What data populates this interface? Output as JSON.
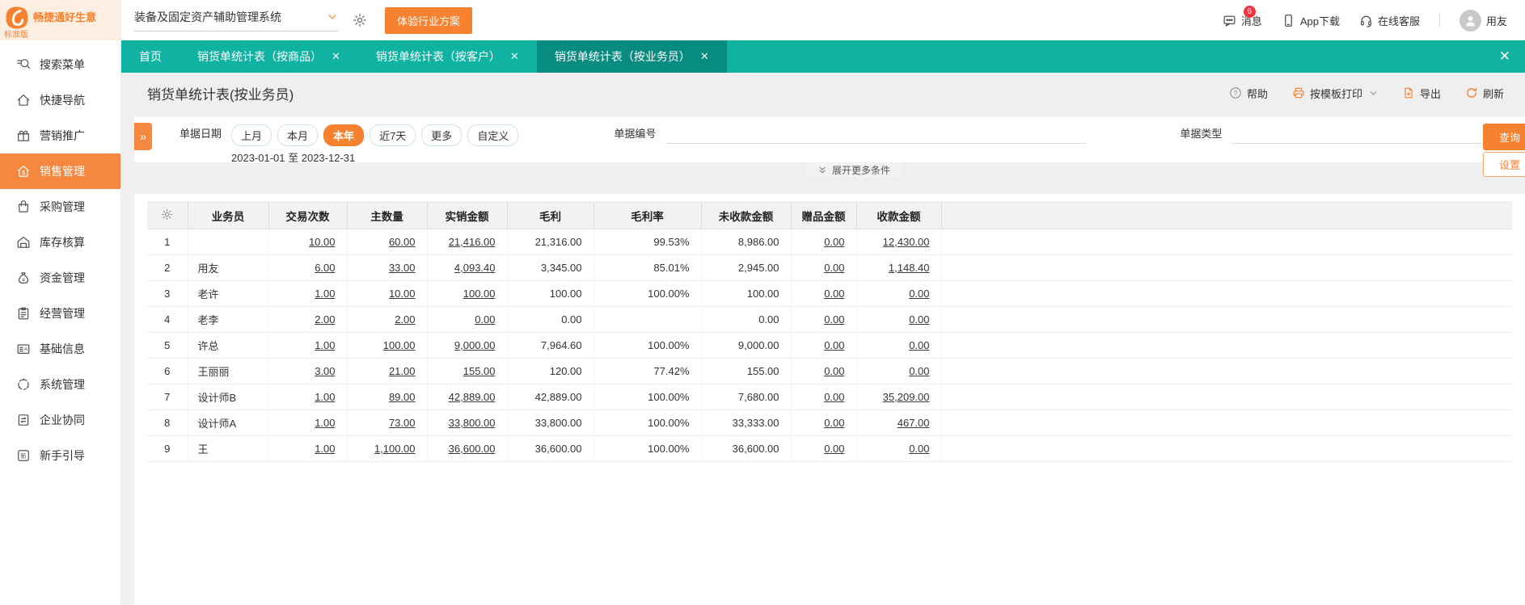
{
  "colors": {
    "accent_orange": "#f6812f",
    "teal": "#10b2a2",
    "teal_active_tab": "#088b80",
    "badge_red": "#f4333c",
    "sidebar_active": "#f6873f"
  },
  "topbar": {
    "logo_title": "畅捷通好生意",
    "logo_subtitle": "标准版",
    "system_select_value": "装备及固定资产辅助管理系统",
    "trial_button": "体验行业方案",
    "messages_label": "消息",
    "messages_badge": "6",
    "app_download_label": "App下载",
    "online_service_label": "在线客服",
    "username": "用友"
  },
  "sidebar": {
    "items": [
      {
        "label": "搜索菜单",
        "icon": "search",
        "active": false
      },
      {
        "label": "快捷导航",
        "icon": "home",
        "active": false
      },
      {
        "label": "营销推广",
        "icon": "gift",
        "active": false
      },
      {
        "label": "销售管理",
        "icon": "sales",
        "active": true
      },
      {
        "label": "采购管理",
        "icon": "bag",
        "active": false
      },
      {
        "label": "库存核算",
        "icon": "warehouse",
        "active": false
      },
      {
        "label": "资金管理",
        "icon": "moneybag",
        "active": false
      },
      {
        "label": "经营管理",
        "icon": "clipboard",
        "active": false
      },
      {
        "label": "基础信息",
        "icon": "idcard",
        "active": false
      },
      {
        "label": "系统管理",
        "icon": "system",
        "active": false
      },
      {
        "label": "企业协同",
        "icon": "collab",
        "active": false
      },
      {
        "label": "新手引导",
        "icon": "guide",
        "active": false
      }
    ]
  },
  "tabs": [
    {
      "label": "首页",
      "closable": false,
      "active": false
    },
    {
      "label": "销货单统计表（按商品）",
      "closable": true,
      "active": false
    },
    {
      "label": "销货单统计表（按客户）",
      "closable": true,
      "active": false
    },
    {
      "label": "销货单统计表（按业务员）",
      "closable": true,
      "active": true
    }
  ],
  "page": {
    "title": "销货单统计表(按业务员)",
    "toolbar": {
      "help": "帮助",
      "print": "按模板打印",
      "export": "导出",
      "refresh": "刷新"
    }
  },
  "filters": {
    "date_label": "单据日期",
    "date_options": [
      "上月",
      "本月",
      "本年",
      "近7天",
      "更多",
      "自定义"
    ],
    "date_selected": "本年",
    "date_range": "2023-01-01 至 2023-12-31",
    "doc_no_label": "单据编号",
    "doc_no_value": "",
    "doc_type_label": "单据类型",
    "doc_type_value": "",
    "query_button": "查询",
    "settings_button": "设置",
    "expand_more": "展开更多条件"
  },
  "table": {
    "columns": [
      "业务员",
      "交易次数",
      "主数量",
      "实销金额",
      "毛利",
      "毛利率",
      "未收款金额",
      "赠品金额",
      "收款金额"
    ],
    "link_value_indices": [
      0,
      1,
      2,
      6,
      7
    ],
    "rows": [
      {
        "no": "1",
        "name": "",
        "values": [
          "10.00",
          "60.00",
          "21,416.00",
          "21,316.00",
          "99.53%",
          "8,986.00",
          "0.00",
          "12,430.00"
        ]
      },
      {
        "no": "2",
        "name": "用友",
        "values": [
          "6.00",
          "33.00",
          "4,093.40",
          "3,345.00",
          "85.01%",
          "2,945.00",
          "0.00",
          "1,148.40"
        ]
      },
      {
        "no": "3",
        "name": "老许",
        "values": [
          "1.00",
          "10.00",
          "100.00",
          "100.00",
          "100.00%",
          "100.00",
          "0.00",
          "0.00"
        ]
      },
      {
        "no": "4",
        "name": "老李",
        "values": [
          "2.00",
          "2.00",
          "0.00",
          "0.00",
          "",
          "0.00",
          "0.00",
          "0.00"
        ]
      },
      {
        "no": "5",
        "name": "许总",
        "values": [
          "1.00",
          "100.00",
          "9,000.00",
          "7,964.60",
          "100.00%",
          "9,000.00",
          "0.00",
          "0.00"
        ]
      },
      {
        "no": "6",
        "name": "王丽丽",
        "values": [
          "3.00",
          "21.00",
          "155.00",
          "120.00",
          "77.42%",
          "155.00",
          "0.00",
          "0.00"
        ]
      },
      {
        "no": "7",
        "name": "设计师B",
        "values": [
          "1.00",
          "89.00",
          "42,889.00",
          "42,889.00",
          "100.00%",
          "7,680.00",
          "0.00",
          "35,209.00"
        ]
      },
      {
        "no": "8",
        "name": "设计师A",
        "values": [
          "1.00",
          "73.00",
          "33,800.00",
          "33,800.00",
          "100.00%",
          "33,333.00",
          "0.00",
          "467.00"
        ]
      },
      {
        "no": "9",
        "name": "王",
        "values": [
          "1.00",
          "1,100.00",
          "36,600.00",
          "36,600.00",
          "100.00%",
          "36,600.00",
          "0.00",
          "0.00"
        ]
      }
    ]
  }
}
